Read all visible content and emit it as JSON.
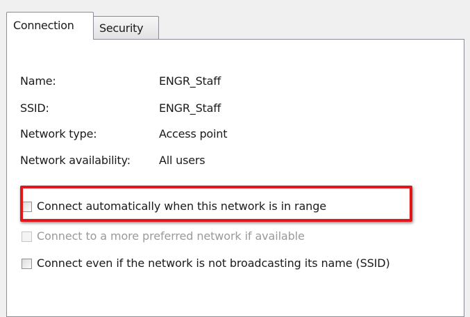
{
  "tabs": [
    {
      "label": "Connection",
      "active": true
    },
    {
      "label": "Security",
      "active": false
    }
  ],
  "info": {
    "name": {
      "label": "Name:",
      "value": "ENGR_Staff"
    },
    "ssid": {
      "label": "SSID:",
      "value": "ENGR_Staff"
    },
    "network_type": {
      "label": "Network type:",
      "value": "Access point"
    },
    "network_availability": {
      "label": "Network availability:",
      "value": "All users"
    }
  },
  "options": {
    "connect_automatically": {
      "label": "Connect automatically when this network is in range",
      "checked": false,
      "enabled": true
    },
    "connect_preferred": {
      "label": "Connect to a more preferred network if available",
      "checked": false,
      "enabled": false
    },
    "connect_not_broadcasting": {
      "label": "Connect even if the network is not broadcasting its name (SSID)",
      "checked": false,
      "enabled": true
    }
  },
  "colors": {
    "highlight": "#e3151a",
    "disabled_text": "#9a9a9a"
  }
}
